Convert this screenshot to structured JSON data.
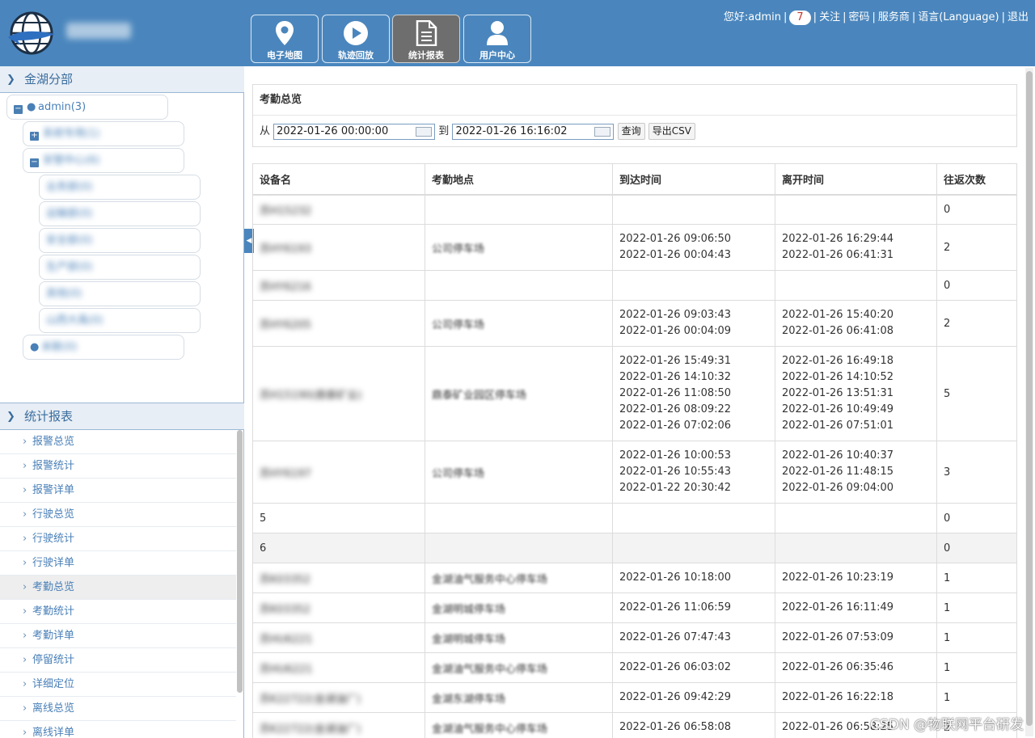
{
  "header": {
    "nav": [
      {
        "label": "电子地图",
        "icon": "map-pin-icon"
      },
      {
        "label": "轨迹回放",
        "icon": "play-icon"
      },
      {
        "label": "统计报表",
        "icon": "document-icon",
        "active": true
      },
      {
        "label": "用户中心",
        "icon": "user-icon"
      }
    ],
    "greeting": "您好:admin",
    "alert_count": "7",
    "links": [
      "关注",
      "密码",
      "服务商",
      "语言(Language)",
      "退出"
    ]
  },
  "sidebar": {
    "group_title": "金湖分部",
    "tree": {
      "root": "admin(3)",
      "children": [
        {
          "label": "系统专用(1)"
        },
        {
          "label": "安管中心(6)"
        },
        {
          "label": "业务部(0)"
        },
        {
          "label": "运输部(0)"
        },
        {
          "label": "安全部(0)"
        },
        {
          "label": "生产部(0)"
        },
        {
          "label": "其他(0)"
        },
        {
          "label": "山西大禹(0)"
        },
        {
          "label": "未联(0)"
        }
      ]
    },
    "report_title": "统计报表",
    "report_items": [
      "报警总览",
      "报警统计",
      "报警详单",
      "行驶总览",
      "行驶统计",
      "行驶详单",
      "考勤总览",
      "考勤统计",
      "考勤详单",
      "停留统计",
      "详细定位",
      "离线总览",
      "离线详单"
    ],
    "active_report": "考勤总览"
  },
  "query": {
    "title": "考勤总览",
    "from_label": "从",
    "from_value": "2022-01-26 00:00:00",
    "to_label": "到",
    "to_value": "2022-01-26 16:16:02",
    "query_button": "查询",
    "export_button": "导出CSV"
  },
  "table": {
    "columns": [
      "设备名",
      "考勤地点",
      "到达时间",
      "离开时间",
      "往返次数"
    ],
    "rows": [
      {
        "device": "苏H15232",
        "place": "",
        "arrive": [],
        "leave": [],
        "count": "0"
      },
      {
        "device": "苏HY6193",
        "place": "公司停车场",
        "arrive": [
          "2022-01-26 09:06:50",
          "2022-01-26 00:04:43"
        ],
        "leave": [
          "2022-01-26 16:29:44",
          "2022-01-26 06:41:31"
        ],
        "count": "2"
      },
      {
        "device": "苏HY6216",
        "place": "",
        "arrive": [],
        "leave": [],
        "count": "0"
      },
      {
        "device": "苏HY6205",
        "place": "公司停车场",
        "arrive": [
          "2022-01-26 09:03:43",
          "2022-01-26 00:04:09"
        ],
        "leave": [
          "2022-01-26 15:40:20",
          "2022-01-26 06:41:08"
        ],
        "count": "2"
      },
      {
        "device": "苏H15190(鼎泰矿业)",
        "place": "鼎泰矿业园区停车场",
        "arrive": [
          "2022-01-26 15:49:31",
          "2022-01-26 14:10:32",
          "2022-01-26 11:08:50",
          "2022-01-26 08:09:22",
          "2022-01-26 07:02:06"
        ],
        "leave": [
          "2022-01-26 16:49:18",
          "2022-01-26 14:10:52",
          "2022-01-26 13:51:31",
          "2022-01-26 10:49:49",
          "2022-01-26 07:51:01"
        ],
        "count": "5"
      },
      {
        "device": "苏HY6197",
        "place": "公司停车场",
        "arrive": [
          "2022-01-26 10:00:53",
          "2022-01-26 10:55:43",
          "2022-01-22 20:30:42"
        ],
        "leave": [
          "2022-01-26 10:40:37",
          "2022-01-26 11:48:15",
          "2022-01-26 09:04:00"
        ],
        "count": "3"
      },
      {
        "device": "5",
        "place": "",
        "arrive": [],
        "leave": [],
        "count": "0",
        "plain_device": true
      },
      {
        "device": "6",
        "place": "",
        "arrive": [],
        "leave": [],
        "count": "0",
        "plain_device": true,
        "shaded": true
      },
      {
        "device": "苏K03352",
        "place": "金湖油气服务中心停车场",
        "arrive": [
          "2022-01-26 10:18:00"
        ],
        "leave": [
          "2022-01-26 10:23:19"
        ],
        "count": "1"
      },
      {
        "device": "苏K03352",
        "place": "金湖明城停车场",
        "arrive": [
          "2022-01-26 11:06:59"
        ],
        "leave": [
          "2022-01-26 16:11:49"
        ],
        "count": "1"
      },
      {
        "device": "苏HU6221",
        "place": "金湖明城停车场",
        "arrive": [
          "2022-01-26 07:47:43"
        ],
        "leave": [
          "2022-01-26 07:53:09"
        ],
        "count": "1"
      },
      {
        "device": "苏HU6221",
        "place": "金湖油气服务中心停车场",
        "arrive": [
          "2022-01-26 06:03:02"
        ],
        "leave": [
          "2022-01-26 06:35:46"
        ],
        "count": "1"
      },
      {
        "device": "苏K22722(金湖油厂)",
        "place": "金湖东湖停车场",
        "arrive": [
          "2022-01-26 09:42:29"
        ],
        "leave": [
          "2022-01-26 16:22:18"
        ],
        "count": "1"
      },
      {
        "device": "苏K22722(金湖油厂)",
        "place": "金湖油气服务中心停车场",
        "arrive": [
          "2022-01-26 06:58:08"
        ],
        "leave": [
          "2022-01-26 06:58:25"
        ],
        "count": "2"
      }
    ]
  },
  "watermark": "CSDN @物联网平台研发",
  "colors": {
    "header_bg": "#4a86bd",
    "accent": "#4a80b8",
    "badge_text": "#c0392b"
  }
}
